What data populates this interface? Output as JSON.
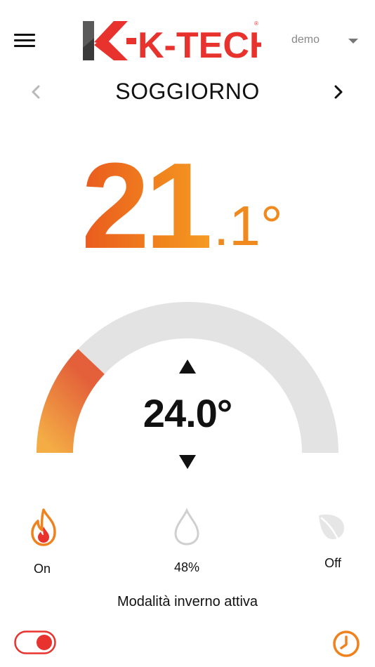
{
  "header": {
    "brand": "K-TECH",
    "user": "demo"
  },
  "room": {
    "name": "SOGGIORNO"
  },
  "temperature": {
    "integer": "21",
    "decimal": ".1°"
  },
  "setpoint": {
    "value": "24.0°"
  },
  "status": {
    "heating": "On",
    "humidity": "48%",
    "eco": "Off",
    "mode": "Modalità inverno attiva"
  },
  "toggle": {
    "on": true
  },
  "colors": {
    "accent": "#f0821e",
    "accent_dark": "#ea5a1e",
    "toggle_red": "#e8322d",
    "gauge_track": "#e3e3e3"
  },
  "icons": {
    "menu": "hamburger-icon",
    "prev": "chevron-left-icon",
    "next": "chevron-right-icon",
    "up": "triangle-up-icon",
    "down": "triangle-down-icon",
    "heating": "flame-icon",
    "humidity": "drop-icon",
    "eco": "leaf-icon",
    "schedule": "clock-icon"
  }
}
